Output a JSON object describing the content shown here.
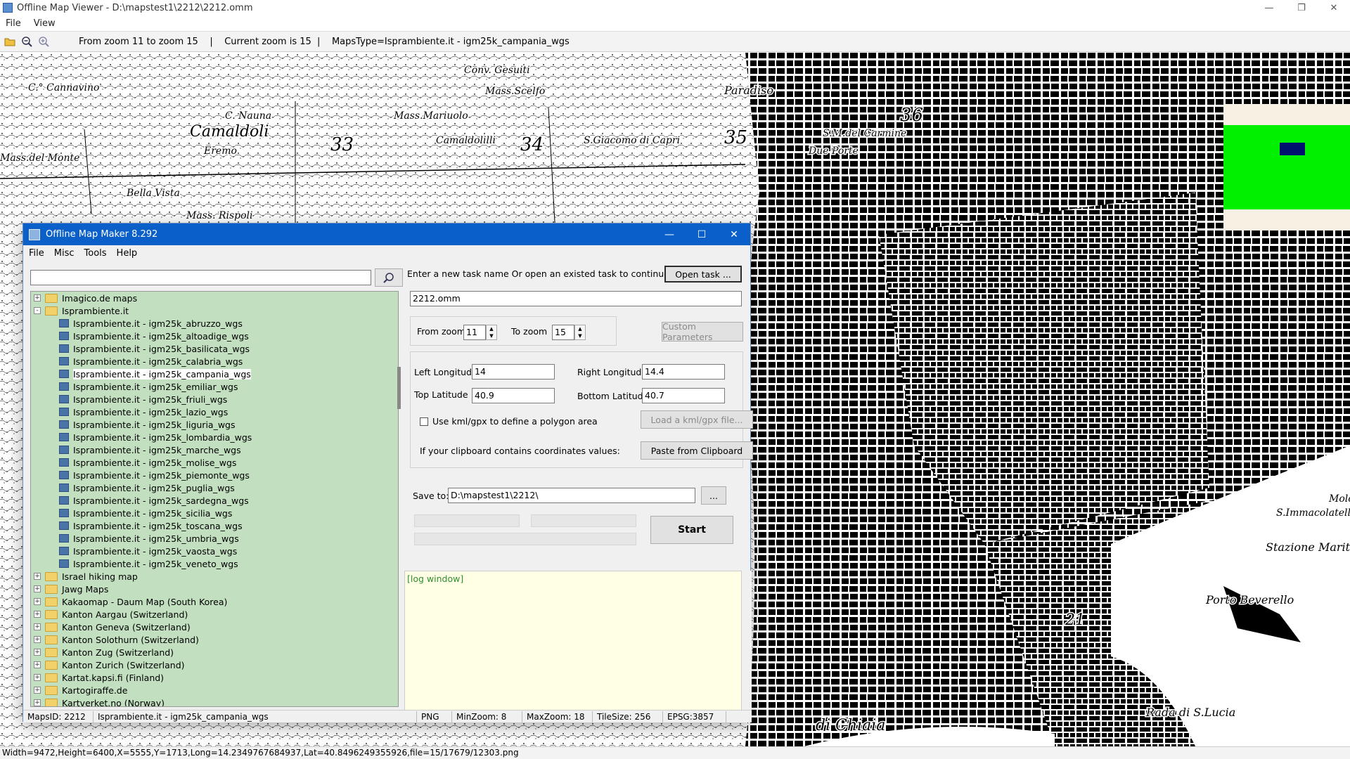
{
  "viewer": {
    "title": "Offline Map Viewer - D:\\mapstest1\\2212\\2212.omm",
    "menu": [
      "File",
      "View"
    ],
    "toolbar_status": "From zoom 11 to zoom 15    |    Current zoom is 15  |    MapsType=Isprambiente.it - igm25k_campania_wgs",
    "statusbar": "Width=9472,Height=6400,X=5555,Y=1713,Long=14.2349767684937,Lat=40.8496249355926,file=15/17679/12303.png",
    "map_labels": [
      "C.° Cannavino",
      "Mass.del Monte",
      "Camaldoli",
      "Eremo",
      "Bella Vista",
      "Mass. Rispoli",
      "C. Nauna",
      "Conv. Gesuiti",
      "Mass.Scelfo",
      "Mass.Mariuolo",
      "Camaldolilli",
      "S.Giacomo di Capri",
      "Paradiso",
      "S.M.del Carmine",
      "Due Porte",
      "Stazione Marittima",
      "Porto Beverello",
      "S.Immacolatella",
      "Rada di S.Lucia",
      "di Chiaia",
      "Molo",
      "33",
      "34",
      "35",
      "36",
      "21"
    ],
    "icons": [
      "open-folder-icon",
      "zoom-out-icon",
      "zoom-in-icon"
    ]
  },
  "dialog": {
    "title": "Offline Map Maker 8.292",
    "menu": [
      "File",
      "Misc",
      "Tools",
      "Help"
    ],
    "search_placeholder": "",
    "tree": {
      "top": [
        {
          "label": "Imagico.de maps",
          "expander": "+"
        },
        {
          "label": "Isprambiente.it",
          "expander": "-"
        }
      ],
      "children": [
        "Isprambiente.it - igm25k_abruzzo_wgs",
        "Isprambiente.it - igm25k_altoadige_wgs",
        "Isprambiente.it - igm25k_basilicata_wgs",
        "Isprambiente.it - igm25k_calabria_wgs",
        "Isprambiente.it - igm25k_campania_wgs",
        "Isprambiente.it - igm25k_emiliar_wgs",
        "Isprambiente.it - igm25k_friuli_wgs",
        "Isprambiente.it - igm25k_lazio_wgs",
        "Isprambiente.it - igm25k_liguria_wgs",
        "Isprambiente.it - igm25k_lombardia_wgs",
        "Isprambiente.it - igm25k_marche_wgs",
        "Isprambiente.it - igm25k_molise_wgs",
        "Isprambiente.it - igm25k_piemonte_wgs",
        "Isprambiente.it - igm25k_puglia_wgs",
        "Isprambiente.it - igm25k_sardegna_wgs",
        "Isprambiente.it - igm25k_sicilia_wgs",
        "Isprambiente.it - igm25k_toscana_wgs",
        "Isprambiente.it - igm25k_umbria_wgs",
        "Isprambiente.it - igm25k_vaosta_wgs",
        "Isprambiente.it - igm25k_veneto_wgs"
      ],
      "selected": "Isprambiente.it - igm25k_campania_wgs",
      "bottom": [
        "Israel hiking map",
        "Jawg Maps",
        "Kakaomap - Daum Map (South Korea)",
        "Kanton Aargau (Switzerland)",
        "Kanton Geneva (Switzerland)",
        "Kanton Solothurn (Switzerland)",
        "Kanton Zug (Switzerland)",
        "Kanton Zurich (Switzerland)",
        "Kartat.kapsi.fi (Finland)",
        "Kartogiraffe.de",
        "Kartverket.no (Norway)"
      ]
    },
    "form": {
      "task_prompt": "Enter a new task name Or open an existed task to continue:",
      "open_task_btn": "Open task ...",
      "task_name": "2212.omm",
      "from_zoom_label": "From zoom",
      "from_zoom": "11",
      "to_zoom_label": "To zoom",
      "to_zoom": "15",
      "custom_params_btn": "Custom Parameters",
      "left_lon_label": "Left Longitude",
      "left_lon": "14",
      "right_lon_label": "Right Longitude",
      "right_lon": "14.4",
      "top_lat_label": "Top Latitude",
      "top_lat": "40.9",
      "bottom_lat_label": "Bottom Latitude",
      "bottom_lat": "40.7",
      "kml_label": "Use kml/gpx to define a polygon area",
      "load_kml_btn": "Load a kml/gpx file...",
      "clipboard_label": "If your clipboard contains coordinates values:",
      "paste_btn": "Paste from Clipboard",
      "save_to_label": "Save to:",
      "save_to": "D:\\mapstest1\\2212\\",
      "browse_btn": "...",
      "start_btn": "Start",
      "log_text": "[log window]"
    },
    "statusbar": {
      "maps_id": "MapsID: 2212",
      "maps_name": "Isprambiente.it - igm25k_campania_wgs",
      "format": "PNG",
      "min_zoom": "MinZoom: 8",
      "max_zoom": "MaxZoom: 18",
      "tile_size": "TileSize: 256",
      "epsg": "EPSG:3857"
    }
  }
}
